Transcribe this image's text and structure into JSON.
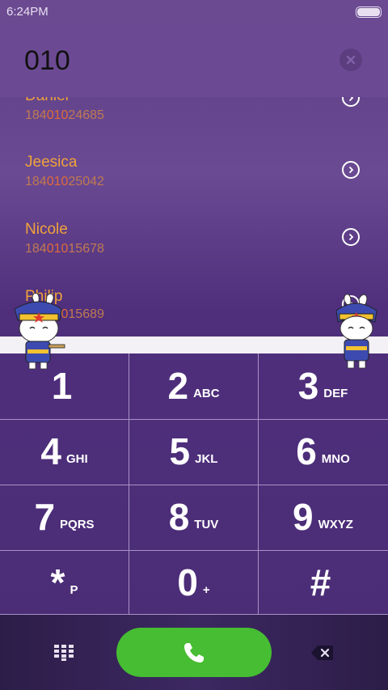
{
  "status": {
    "time": "6:24PM"
  },
  "dialer": {
    "input": "010"
  },
  "contacts": [
    {
      "name": "Daniel",
      "num_pre": "184",
      "num_hl": "010",
      "num_post": "24685"
    },
    {
      "name": "Jeesica",
      "num_pre": "184",
      "num_hl": "010",
      "num_post": "25042"
    },
    {
      "name": "Nicole",
      "num_pre": "184",
      "num_hl": "010",
      "num_post": "15678"
    },
    {
      "name": "Philip",
      "num_pre": "184",
      "num_hl": "010",
      "num_post": "15689"
    }
  ],
  "keys": [
    {
      "digit": "1",
      "letters": ""
    },
    {
      "digit": "2",
      "letters": "ABC"
    },
    {
      "digit": "3",
      "letters": "DEF"
    },
    {
      "digit": "4",
      "letters": "GHI"
    },
    {
      "digit": "5",
      "letters": "JKL"
    },
    {
      "digit": "6",
      "letters": "MNO"
    },
    {
      "digit": "7",
      "letters": "PQRS"
    },
    {
      "digit": "8",
      "letters": "TUV"
    },
    {
      "digit": "9",
      "letters": "WXYZ"
    },
    {
      "digit": "*",
      "letters": "P"
    },
    {
      "digit": "0",
      "letters": "+"
    },
    {
      "digit": "#",
      "letters": ""
    }
  ],
  "icons": {
    "clear": "close-icon",
    "arrow": "chevron-right-icon",
    "call": "phone-icon",
    "keypad": "keypad-grid-icon",
    "backspace": "backspace-icon"
  },
  "colors": {
    "accent_orange": "#f1a23a",
    "match_highlight": "#e26a3a",
    "call_green": "#46bd32",
    "background_purple": "#4f2f7c"
  }
}
